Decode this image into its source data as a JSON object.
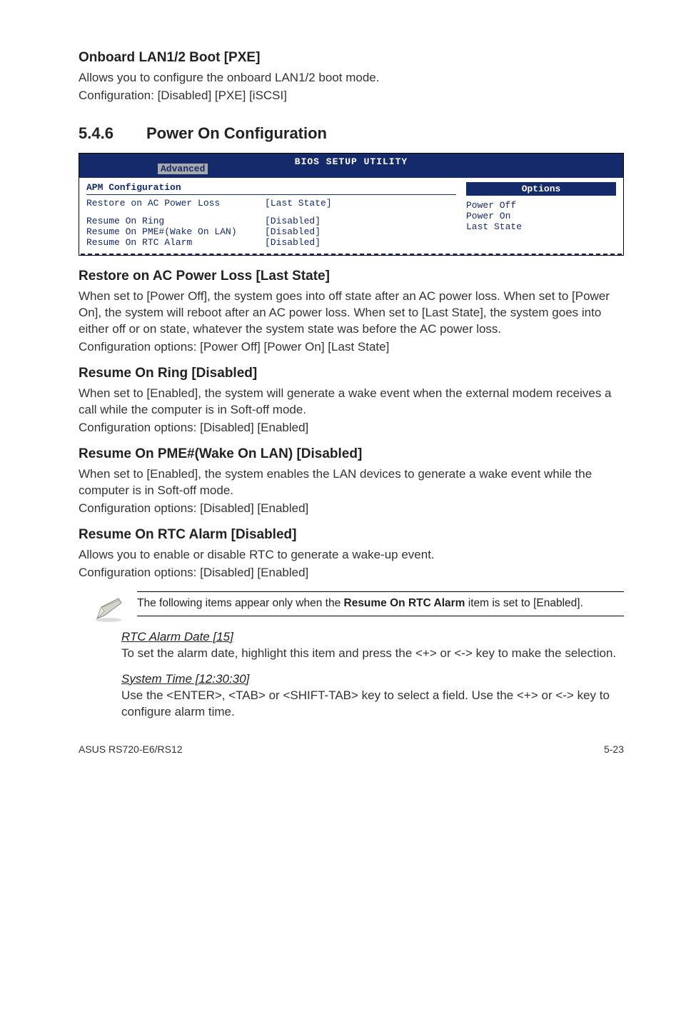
{
  "h_onboard": "Onboard LAN1/2 Boot [PXE]",
  "p_onboard1": "Allows you to configure the onboard LAN1/2 boot mode.",
  "p_onboard2": "Configuration: [Disabled] [PXE] [iSCSI]",
  "section_num": "5.4.6",
  "section_title": "Power On Configuration",
  "bios": {
    "utility_title": "BIOS SETUP UTILITY",
    "tab": "Advanced",
    "config_title": "APM Configuration",
    "rows": [
      {
        "label": "Restore on AC Power Loss",
        "value": "[Last State]"
      },
      {
        "label": "Resume On Ring",
        "value": "[Disabled]"
      },
      {
        "label": "Resume On PME#(Wake On LAN)",
        "value": "[Disabled]"
      },
      {
        "label": "Resume On RTC Alarm",
        "value": "[Disabled]"
      }
    ],
    "options_head": "Options",
    "options": [
      "Power Off",
      "Power On",
      "Last State"
    ]
  },
  "h_restore": "Restore on AC Power Loss [Last State]",
  "p_restore1": "When set to [Power Off], the system goes into off state after an AC power loss. When set to [Power On], the system will reboot after an AC power loss. When set to [Last State], the system goes into either off or on state, whatever the system state was before the AC power loss.",
  "p_restore2": "Configuration options: [Power Off] [Power On] [Last State]",
  "h_ring": "Resume On Ring [Disabled]",
  "p_ring1": "When set to [Enabled], the system will generate a wake event when the external modem receives a call while the computer is in Soft-off mode.",
  "p_ring2": "Configuration options: [Disabled] [Enabled]",
  "h_pme": "Resume On PME#(Wake On LAN) [Disabled]",
  "p_pme1": "When set to [Enabled], the system enables the LAN devices to generate a wake event while the computer is in Soft-off mode.",
  "p_pme2": "Configuration options: [Disabled] [Enabled]",
  "h_rtc": "Resume On RTC Alarm [Disabled]",
  "p_rtc1": "Allows you to enable or disable RTC to generate a wake-up event.",
  "p_rtc2": "Configuration options: [Disabled] [Enabled]",
  "note_pre": "The following items appear only when the ",
  "note_bold": "Resume On RTC Alarm",
  "note_post": " item is set to [Enabled].",
  "sub1_title": "RTC Alarm Date [15]",
  "sub1_body": "To set the alarm date, highlight this item and press the <+> or <-> key to make the selection.",
  "sub2_title": "System Time [12:30:30]",
  "sub2_body": "Use the <ENTER>, <TAB> or <SHIFT-TAB> key to select a field. Use the <+> or <-> key to configure alarm time.",
  "footer_left": "ASUS RS720-E6/RS12",
  "footer_right": "5-23"
}
